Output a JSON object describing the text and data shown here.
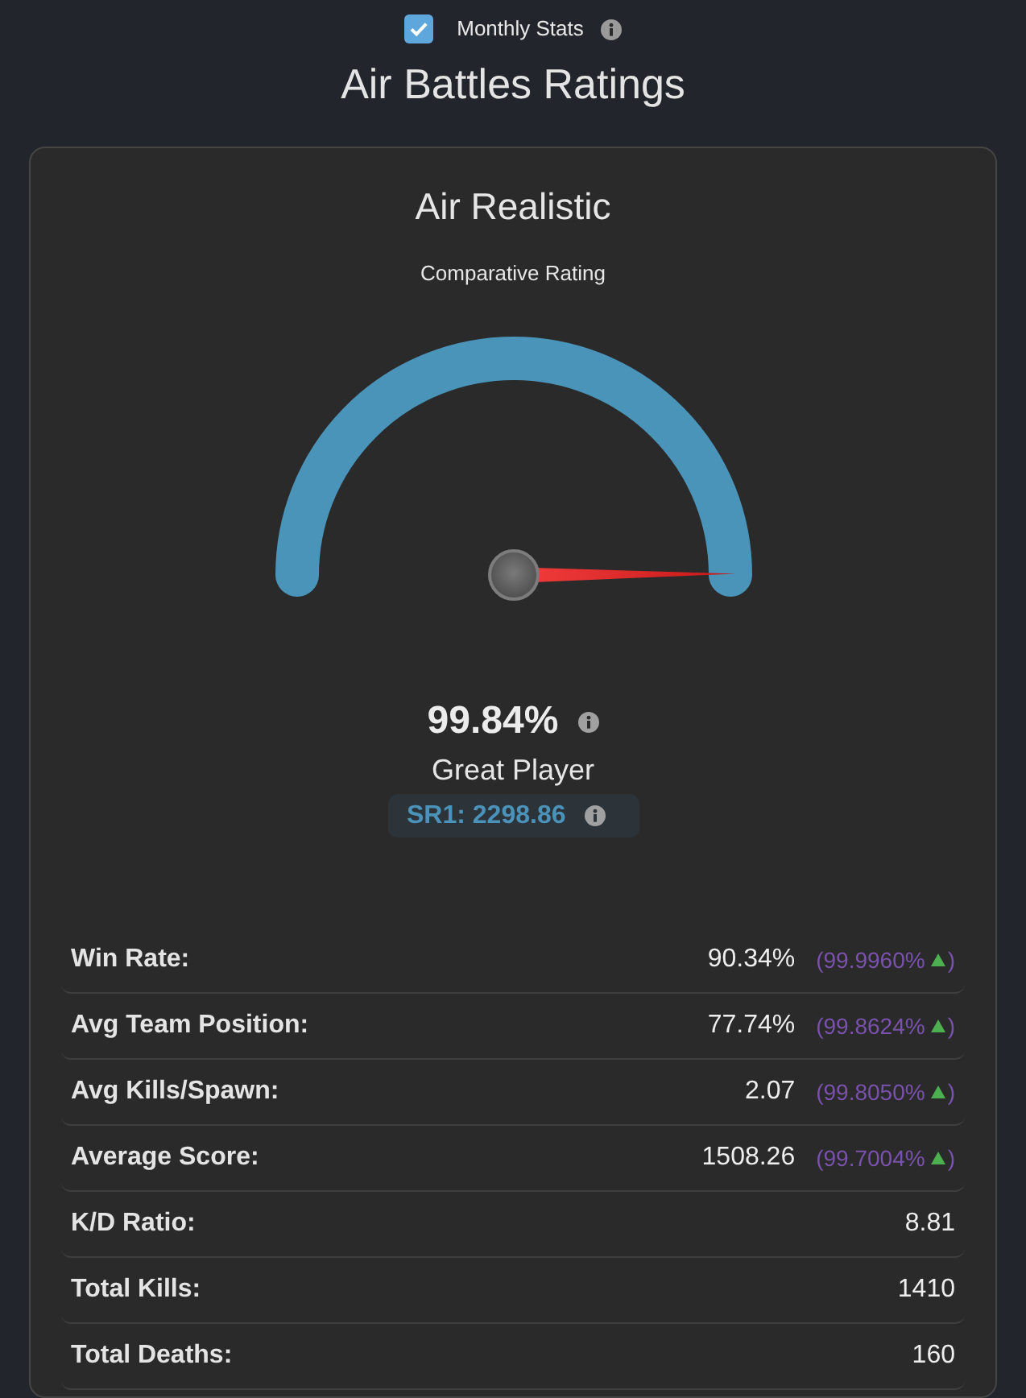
{
  "monthly_stats": {
    "label": "Monthly Stats",
    "checked": true
  },
  "title": "Air Battles Ratings",
  "card": {
    "title": "Air Realistic",
    "subtitle": "Comparative Rating",
    "gauge": {
      "level": 0.9984
    },
    "rating": "99.84%",
    "rank": "Great Player",
    "sr_badge": "SR1: 2298.86",
    "stats": [
      {
        "label": "Win Rate:",
        "value": "90.34%",
        "percentile": {
          "text": "(99.9960%",
          "rising": true,
          "suffix": ")"
        }
      },
      {
        "label": "Avg Team Position:",
        "value": "77.74%",
        "percentile": {
          "text": "(99.8624%",
          "rising": true,
          "suffix": ")"
        }
      },
      {
        "label": "Avg Kills/Spawn:",
        "value": "2.07",
        "percentile": {
          "text": "(99.8050%",
          "rising": true,
          "suffix": ")"
        }
      },
      {
        "label": "Average Score:",
        "value": "1508.26",
        "percentile": {
          "text": "(99.7004%",
          "rising": true,
          "suffix": ")"
        }
      },
      {
        "label": "K/D Ratio:",
        "value": "8.81"
      },
      {
        "label": "Total Kills:",
        "value": "1410"
      },
      {
        "label": "Total Deaths:",
        "value": "160"
      }
    ]
  }
}
